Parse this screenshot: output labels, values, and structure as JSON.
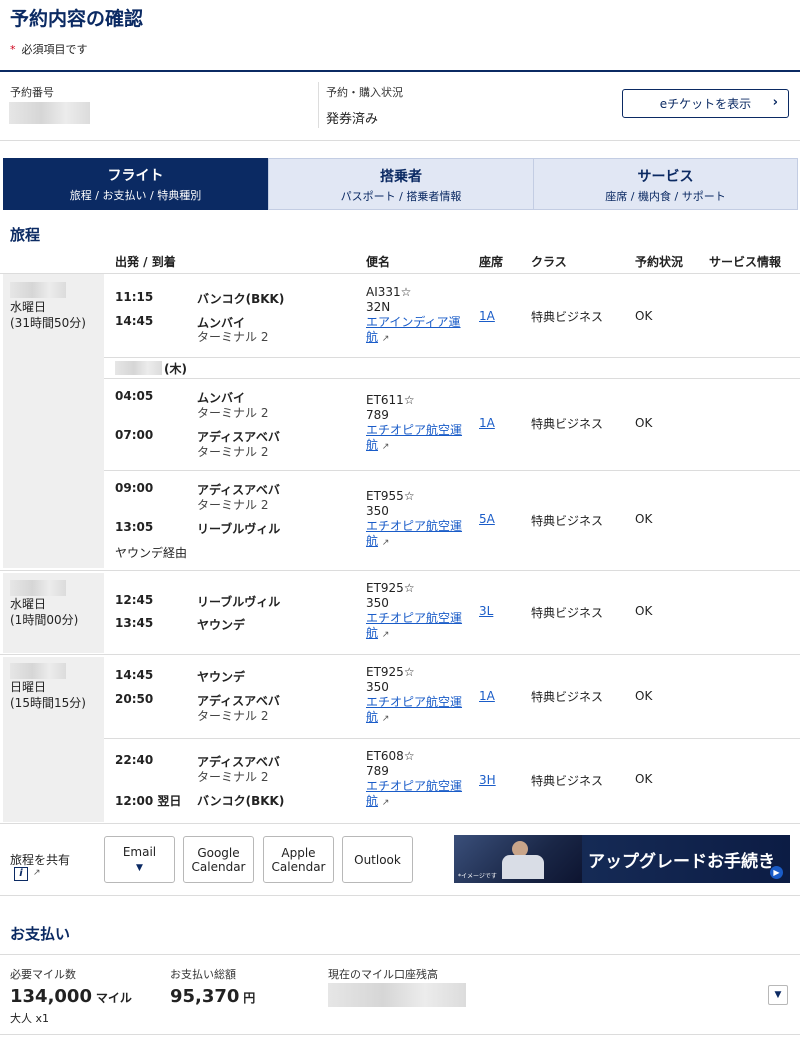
{
  "page": {
    "title": "予約内容の確認",
    "required_mark": "*",
    "required_note": "必須項目です"
  },
  "booking": {
    "number_label": "予約番号",
    "status_label": "予約・購入状況",
    "status_value": "発券済み",
    "eticket_button": "eチケットを表示",
    "eticket_chevron": "›"
  },
  "tabs": [
    {
      "title": "フライト",
      "sub": "旅程 / お支払い / 特典種別"
    },
    {
      "title": "搭乗者",
      "sub": "パスポート / 搭乗者情報"
    },
    {
      "title": "サービス",
      "sub": "座席 / 機内食 / サポート"
    }
  ],
  "itinerary": {
    "heading": "旅程",
    "columns": [
      "出発 / 到着",
      "便名",
      "座席",
      "クラス",
      "予約状況",
      "サービス情報"
    ],
    "days": [
      {
        "weekday": "水曜日",
        "duration": "(31時間50分)"
      },
      {
        "weekday": "水曜日",
        "duration": "(1時間00分)"
      },
      {
        "weekday": "日曜日",
        "duration": "(15時間15分)"
      }
    ],
    "subdate_weekday": "(木)",
    "segments": [
      {
        "dep_time": "11:15",
        "dep_city": "バンコク(BKK)",
        "dep_term": "",
        "arr_time": "14:45",
        "arr_city": "ムンバイ",
        "arr_term": "ターミナル 2",
        "flight": "AI331",
        "aircraft": "32N",
        "carrier1": "エアインディア運",
        "carrier2": "航",
        "seat": "1A",
        "class": "特典ビジネス",
        "status": "OK",
        "via": ""
      },
      {
        "dep_time": "04:05",
        "dep_city": "ムンバイ",
        "dep_term": "ターミナル 2",
        "arr_time": "07:00",
        "arr_city": "アディスアベバ",
        "arr_term": "ターミナル 2",
        "flight": "ET611",
        "aircraft": "789",
        "carrier1": "エチオピア航空運",
        "carrier2": "航",
        "seat": "1A",
        "class": "特典ビジネス",
        "status": "OK",
        "via": ""
      },
      {
        "dep_time": "09:00",
        "dep_city": "アディスアベバ",
        "dep_term": "ターミナル 2",
        "arr_time": "13:05",
        "arr_city": "リーブルヴィル",
        "arr_term": "",
        "flight": "ET955",
        "aircraft": "350",
        "carrier1": "エチオピア航空運",
        "carrier2": "航",
        "seat": "5A",
        "class": "特典ビジネス",
        "status": "OK",
        "via": "ヤウンデ経由"
      },
      {
        "dep_time": "12:45",
        "dep_city": "リーブルヴィル",
        "dep_term": "",
        "arr_time": "13:45",
        "arr_city": "ヤウンデ",
        "arr_term": "",
        "flight": "ET925",
        "aircraft": "350",
        "carrier1": "エチオピア航空運",
        "carrier2": "航",
        "seat": "3L",
        "class": "特典ビジネス",
        "status": "OK",
        "via": ""
      },
      {
        "dep_time": "14:45",
        "dep_city": "ヤウンデ",
        "dep_term": "",
        "arr_time": "20:50",
        "arr_city": "アディスアベバ",
        "arr_term": "ターミナル 2",
        "flight": "ET925",
        "aircraft": "350",
        "carrier1": "エチオピア航空運",
        "carrier2": "航",
        "seat": "1A",
        "class": "特典ビジネス",
        "status": "OK",
        "via": ""
      },
      {
        "dep_time": "22:40",
        "dep_city": "アディスアベバ",
        "dep_term": "ターミナル 2",
        "arr_time": "12:00 翌日",
        "arr_city": "バンコク(BKK)",
        "arr_term": "",
        "flight": "ET608",
        "aircraft": "789",
        "carrier1": "エチオピア航空運",
        "carrier2": "航",
        "seat": "3H",
        "class": "特典ビジネス",
        "status": "OK",
        "via": ""
      }
    ]
  },
  "share": {
    "label": "旅程を共有",
    "info_glyph": "i",
    "email": "Email",
    "google": [
      "Google",
      "Calendar"
    ],
    "apple": [
      "Apple",
      "Calendar"
    ],
    "outlook": "Outlook",
    "banner_text": "アップグレードお手続き",
    "banner_note": "*イメージです"
  },
  "payment": {
    "heading": "お支払い",
    "miles_label": "必要マイル数",
    "miles_value": "134,000",
    "miles_unit": "マイル",
    "pax": "大人 x1",
    "total_label": "お支払い総額",
    "total_value": "95,370",
    "total_unit": "円",
    "balance_label": "現在のマイル口座残高"
  },
  "colors": {
    "navy": "#0b2a63",
    "link": "#1a5cc8",
    "required": "#d0021b"
  },
  "icons": {
    "star": "star-icon",
    "external": "external-link-icon",
    "chevron_right": "chevron-right-icon",
    "chevron_down": "chevron-down-icon",
    "info": "info-icon"
  }
}
